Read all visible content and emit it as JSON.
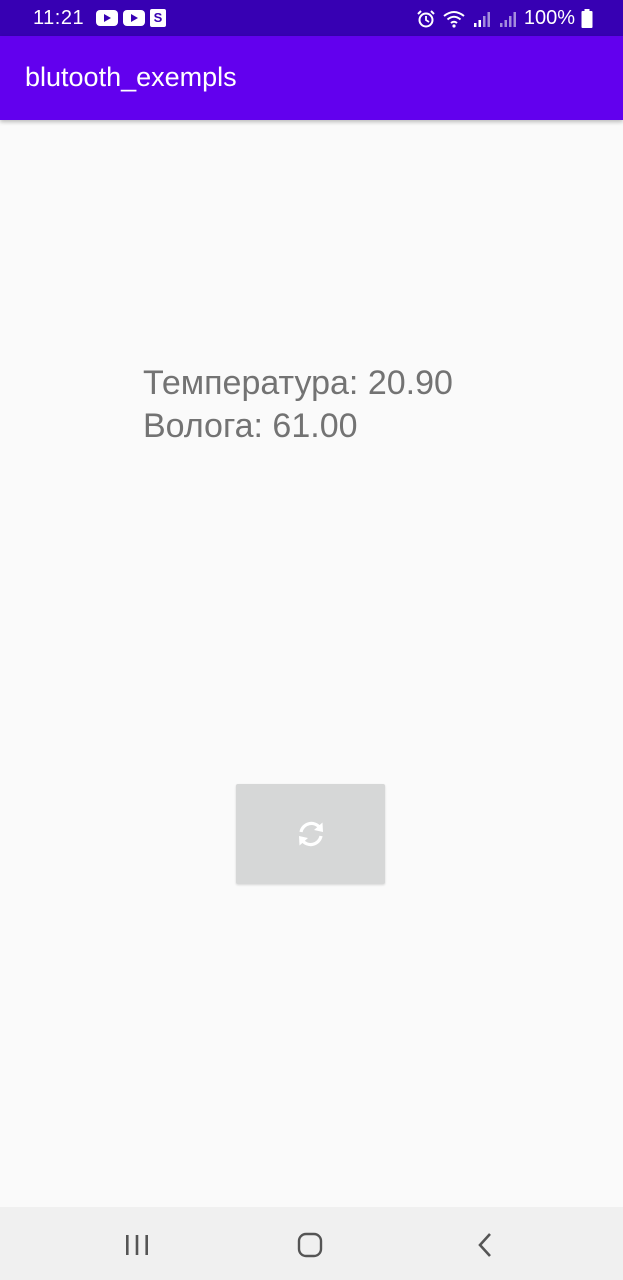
{
  "status_bar": {
    "time": "11:21",
    "battery": "100%",
    "notification_icons": [
      "youtube-icon",
      "youtube-icon",
      "s-app-icon"
    ],
    "system_icons": [
      "alarm-icon",
      "wifi-icon",
      "signal-icon",
      "signal-icon",
      "battery-icon"
    ],
    "s_badge": "S"
  },
  "app_bar": {
    "title": "blutooth_exempls",
    "color": "#6200ee"
  },
  "main": {
    "temperature_line": "Температура: 20.90",
    "humidity_line": "Волога: 61.00",
    "refresh_button_icon": "refresh-icon"
  },
  "nav_bar": {
    "buttons": [
      "recents-icon",
      "home-icon",
      "back-icon"
    ]
  }
}
